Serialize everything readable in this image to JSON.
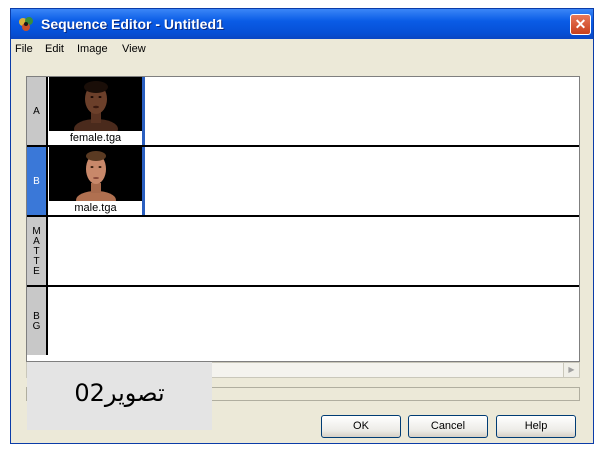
{
  "window": {
    "title": "Sequence Editor - Untitled1",
    "close_glyph": "✕",
    "icon": "app-icon",
    "accent_color": "#0a5ce6"
  },
  "menu": [
    "File",
    "Edit",
    "Image",
    "View"
  ],
  "tracks": [
    {
      "label": [
        "A"
      ],
      "selected": false,
      "clip": "female.tga"
    },
    {
      "label": [
        "B"
      ],
      "selected": true,
      "clip": "male.tga"
    },
    {
      "label": [
        "M",
        "A",
        "T",
        "T",
        "E"
      ],
      "selected": false,
      "clip": null
    },
    {
      "label": [
        "B",
        "G"
      ],
      "selected": false,
      "clip": null
    }
  ],
  "buttons": {
    "ok": "OK",
    "cancel": "Cancel",
    "help": "Help"
  },
  "caption": "تصویر02"
}
